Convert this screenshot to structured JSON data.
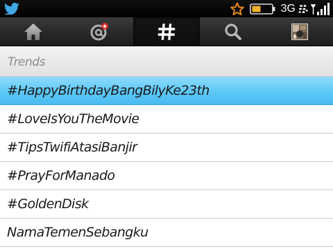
{
  "status_bar": {
    "app_icon": "twitter-bird-icon",
    "notification_icon": "star-icon",
    "battery_icon": "battery-icon",
    "network": "3G",
    "service_icon": "blackberry-icon",
    "signal_icon": "signal-bars-icon",
    "colors": {
      "star": "#e8891c",
      "battery": "#f0b030"
    }
  },
  "navbar": {
    "tabs": [
      {
        "icon": "home-icon",
        "active": false
      },
      {
        "icon": "mentions-icon",
        "active": false
      },
      {
        "icon": "hashtag-icon",
        "active": true
      },
      {
        "icon": "search-icon",
        "active": false
      },
      {
        "icon": "profile-avatar-icon",
        "active": false
      }
    ]
  },
  "section": {
    "title": "Trends"
  },
  "trends": {
    "items": [
      {
        "label": "#HappyBirthdayBangBilyKe23th",
        "selected": true
      },
      {
        "label": "#LoveIsYouTheMovie",
        "selected": false
      },
      {
        "label": "#TipsTwifiAtasiBanjir",
        "selected": false
      },
      {
        "label": "#PrayForManado",
        "selected": false
      },
      {
        "label": "#GoldenDisk",
        "selected": false
      },
      {
        "label": "NamaTemenSebangku",
        "selected": false
      }
    ]
  },
  "colors": {
    "selected_row": "#5cc8f6",
    "nav_background": "#2a2a2a",
    "header_text": "#8c8c8c"
  }
}
